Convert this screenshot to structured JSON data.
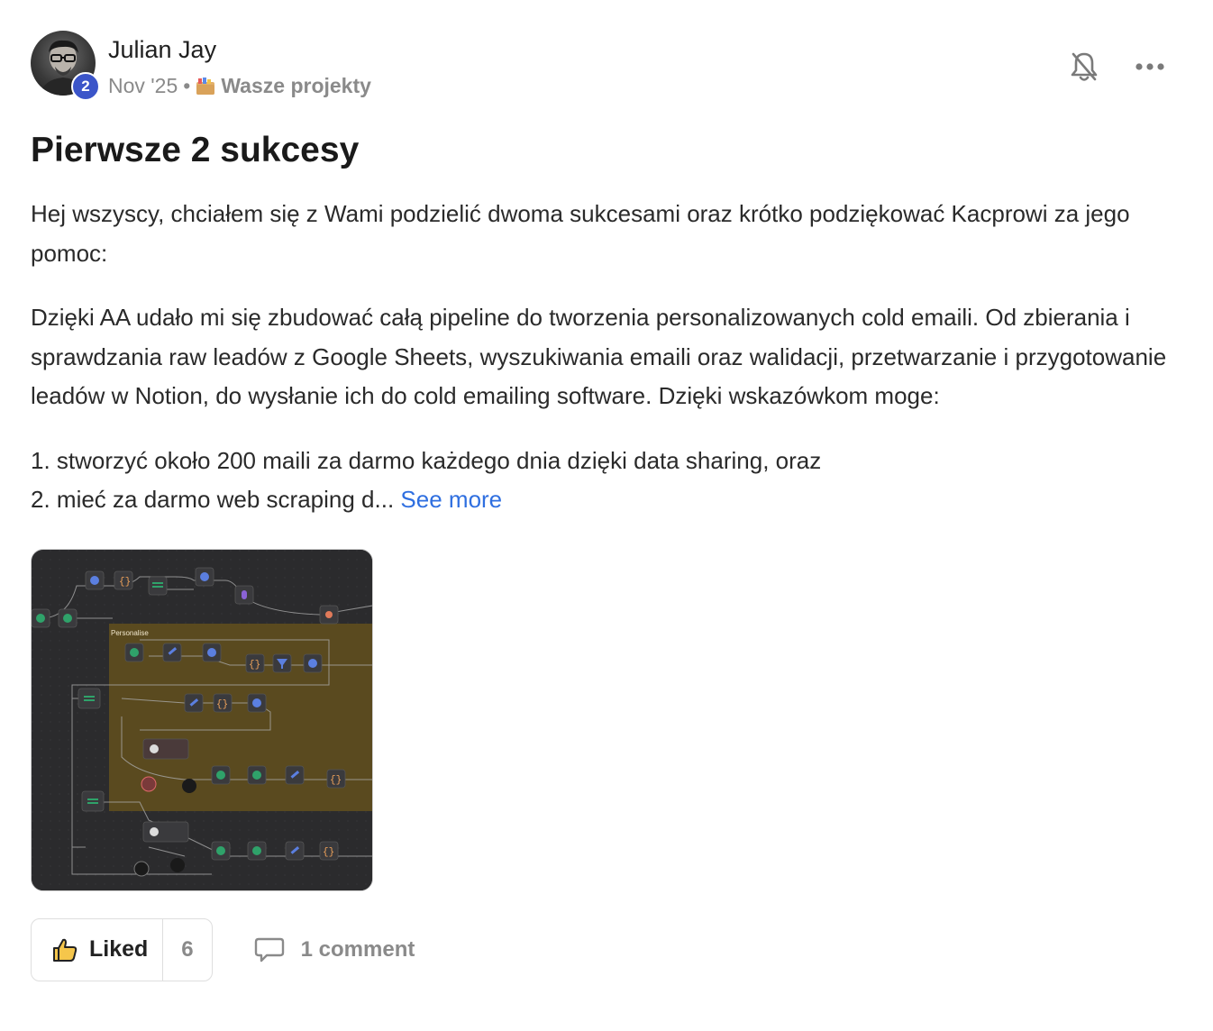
{
  "post": {
    "author": "Julian Jay",
    "level": "2",
    "date": "Nov '25",
    "separator": "•",
    "category": "Wasze projekty",
    "title": "Pierwsze 2 sukcesy",
    "paragraphs": [
      "Hej wszyscy, chciałem się z Wami podzielić dwoma sukcesami oraz krótko podziękować Kacprowi za jego pomoc:",
      "Dzięki AA udało mi się zbudować całą pipeline do tworzenia personalizowanych cold emaili. Od zbierania i sprawdzania raw leadów z Google Sheets, wyszukiwania emaili oraz walidacji, przetwarzanie i przygotowanie leadów w Notion, do wysłanie ich do cold emailing software. Dzięki wskazówkom moge:"
    ],
    "list_items": [
      "1. stworzyć około 200 maili za darmo każdego dnia dzięki data sharing, oraz",
      "2. mieć za darmo web scraping d..."
    ],
    "see_more": "See more",
    "image": {
      "group_label": "Personalise"
    },
    "like_label": "Liked",
    "like_count": "6",
    "comment_label": "1 comment"
  },
  "icons": {
    "bell": "bell-off-icon",
    "more": "more-horizontal-icon",
    "category": "folder-icon",
    "like": "thumbs-up-icon",
    "comment": "comment-icon"
  },
  "colors": {
    "link": "#2f6fe0",
    "badge": "#3b55c9",
    "muted": "#8a8a8a",
    "canvas_bg": "#2c2c2e",
    "group_bg": "#5a4a20",
    "node_green": "#2fa26a"
  }
}
